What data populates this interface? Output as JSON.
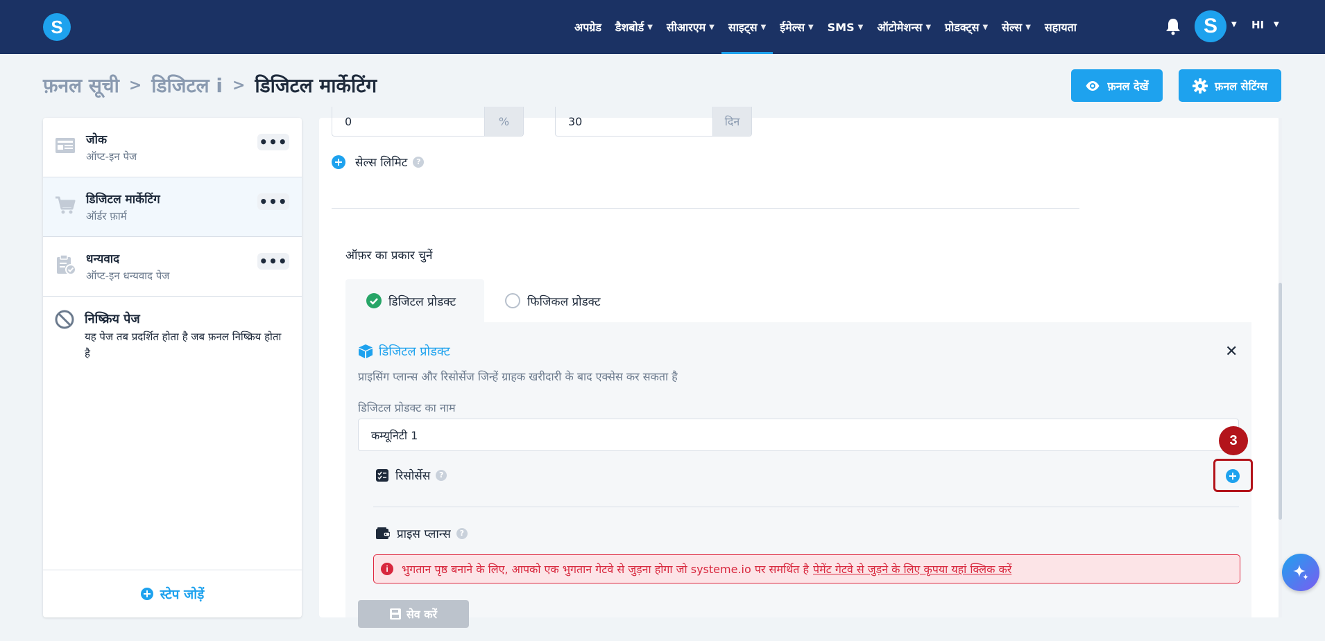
{
  "topnav": {
    "logo_letter": "S",
    "items": [
      {
        "label": "अपग्रेड",
        "has_chevron": false
      },
      {
        "label": "डैशबोर्ड",
        "has_chevron": true
      },
      {
        "label": "सीआरएम",
        "has_chevron": true
      },
      {
        "label": "साइट्स",
        "has_chevron": true,
        "active": true
      },
      {
        "label": "ईमेल्स",
        "has_chevron": true
      },
      {
        "label": "SMS",
        "has_chevron": true
      },
      {
        "label": "ऑटोमेशन्स",
        "has_chevron": true
      },
      {
        "label": "प्रोडक्ट्स",
        "has_chevron": true
      },
      {
        "label": "सेल्स",
        "has_chevron": true
      },
      {
        "label": "सहायता",
        "has_chevron": false
      }
    ],
    "avatar_letter": "S",
    "language": "HI",
    "icons": [
      "bell-icon",
      "chevron-down-icon"
    ]
  },
  "header": {
    "breadcrumb": [
      "फ़नल सूची",
      "डिजिटल i",
      "डिजिटल मार्केटिंग"
    ],
    "view_funnel_label": "फ़नल देखें",
    "funnel_settings_label": "फ़नल सेटिंग्स"
  },
  "sidebar": {
    "steps": [
      {
        "title": "जोक",
        "subtitle": "ऑप्ट-इन पेज",
        "icon": "optin-page-icon",
        "selected": false
      },
      {
        "title": "डिजिटल मार्केटिंग",
        "subtitle": "ऑर्डर फ़ार्म",
        "icon": "cart-icon",
        "selected": true
      },
      {
        "title": "धन्यवाद",
        "subtitle": "ऑप्ट-इन धन्यवाद पेज",
        "icon": "clipboard-check-icon",
        "selected": false
      }
    ],
    "inactive": {
      "title": "निष्क्रिय पेज",
      "description": "यह पेज तब प्रदर्शित होता है जब फ़नल निष्क्रिय होता है"
    },
    "add_step_label": "स्टेप जोड़ें"
  },
  "main": {
    "percent_input": {
      "value": "0",
      "addon": "%"
    },
    "days_input": {
      "value": "30",
      "addon": "दिन"
    },
    "sales_limit_label": "सेल्स लिमिट",
    "offer_type_label": "ऑफ़र का प्रकार चुनें",
    "tabs": [
      {
        "label": "डिजिटल प्रोडक्ट",
        "checked": true
      },
      {
        "label": "फिजिकल प्रोडक्ट",
        "checked": false
      }
    ],
    "digital_product": {
      "title": "डिजिटल प्रोडक्ट",
      "description": "प्राइसिंग प्लान्स और रिसोर्सेज जिन्हें ग्राहक खरीदारी के बाद एक्सेस कर सकता है",
      "name_label": "डिजिटल प्रोडक्ट का नाम",
      "name_value": "कम्यूनिटी 1",
      "resources_label": "रिसोर्सेस",
      "price_plans_label": "प्राइस प्लान्स",
      "alert_text": "भुगतान पृष्ठ बनाने के लिए, आपको एक भुगतान गेटवे से जुड़ना होगा जो systeme.io पर समर्थित है",
      "alert_link": "पेमेंट गेटवे से जुड़ने के लिए कृपया यहां क्लिक करें",
      "save_label": "सेव करें"
    },
    "annotation_number": "3"
  },
  "colors": {
    "nav_bg": "#1b3264",
    "accent": "#1ea2ee",
    "alert_red": "#d8283e",
    "annotation_red": "#b3141b",
    "success_green": "#27a567"
  }
}
